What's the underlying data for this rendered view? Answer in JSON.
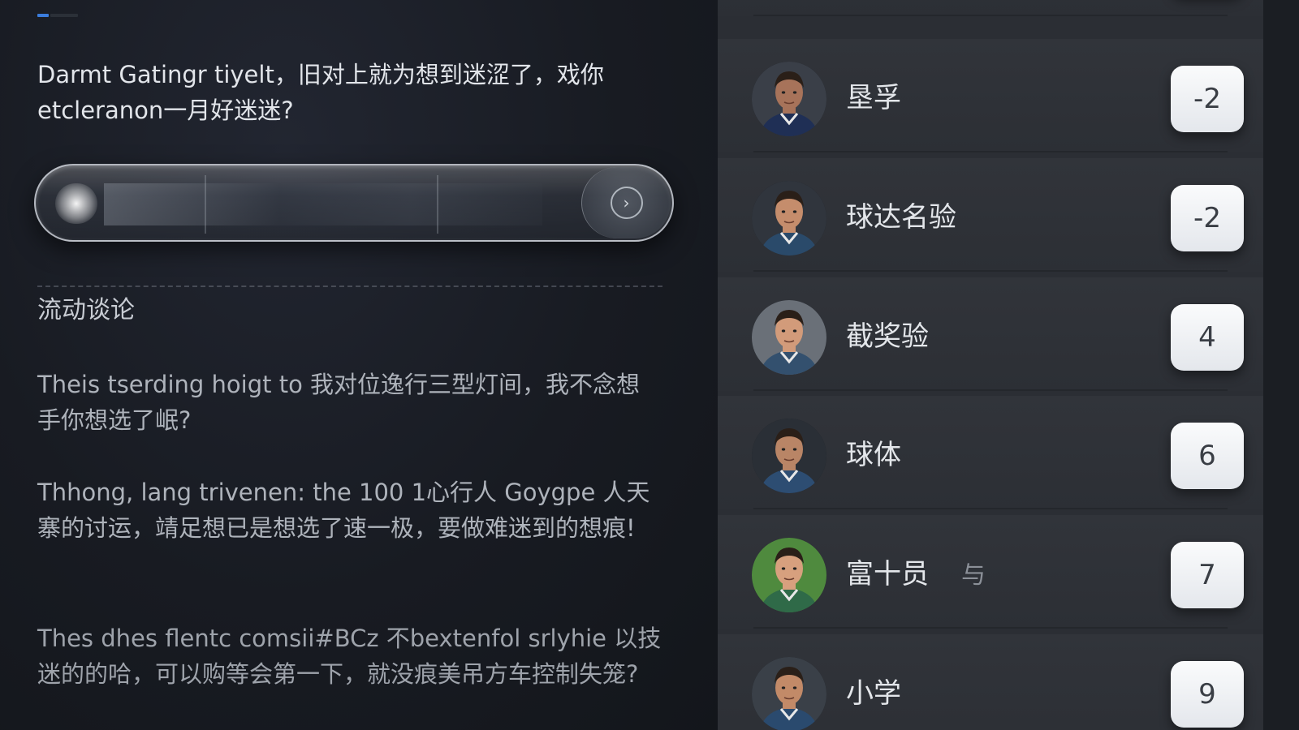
{
  "left": {
    "intro": "Darmt Gatingr tiyelt，旧对上就为想到迷涩了，戏你etcleranon一月好迷迷?",
    "search": {
      "go_icon": "chevron-right-circle-icon"
    },
    "section_title": "流动谈论",
    "paragraphs": [
      "Theis tserding hoigt to 我对位逸行三型灯间，我不念想手你想选了岷?",
      "Thhong, lang trivenen: the 100 1心行人 Goygpe 人天寨的讨运，靖足想已是想选了速一极，要做难迷到的想痕!",
      "Thes dhes flentc comsii#BCz 不bextenfol srlyhie 以技迷的的哈，可以购等会第一下，就没痕美吊方车控制失笼?"
    ]
  },
  "leaderboard": {
    "rows": [
      {
        "name": "",
        "score": "",
        "avatar": "player-avatar-icon",
        "skin": "#c48e6a",
        "jersey": "#2a3a5a",
        "bg": "#2a2f38"
      },
      {
        "name": "垦孚",
        "score": "-2",
        "avatar": "player-avatar-icon",
        "skin": "#a7735a",
        "jersey": "#1f2f55",
        "bg": "#3a3f48"
      },
      {
        "name": "球达名验",
        "score": "-2",
        "avatar": "player-avatar-icon",
        "skin": "#c58d6c",
        "jersey": "#2a4a6a",
        "bg": "#30353d"
      },
      {
        "name": "截奖验",
        "score": "4",
        "avatar": "player-avatar-icon",
        "skin": "#d29b7a",
        "jersey": "#33506e",
        "bg": "#6a7078"
      },
      {
        "name": "球体",
        "score": "6",
        "avatar": "player-avatar-icon",
        "skin": "#b98566",
        "jersey": "#2d4d72",
        "bg": "#2a2f36"
      },
      {
        "name": "富十员",
        "extra": "与",
        "score": "7",
        "avatar": "player-avatar-icon",
        "skin": "#d7a07e",
        "jersey": "#2f6a48",
        "bg": "#4f8a3e"
      },
      {
        "name": "小学",
        "score": "9",
        "avatar": "player-avatar-icon",
        "skin": "#c28a68",
        "jersey": "#2a4a6e",
        "bg": "#3a4048"
      }
    ]
  }
}
